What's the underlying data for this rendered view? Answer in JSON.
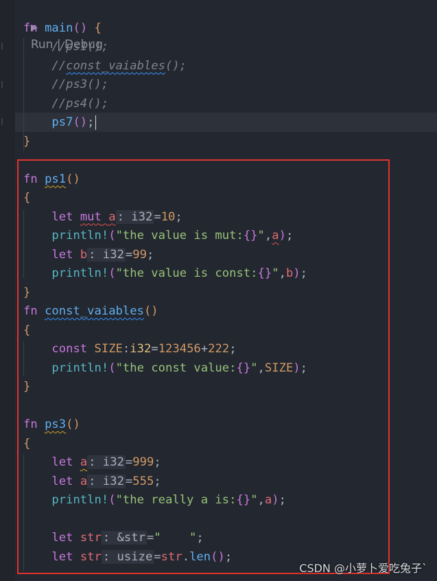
{
  "editor": {
    "codelens": {
      "run": "Run",
      "separator": " | ",
      "debug": "Debug"
    },
    "lines": [
      {
        "tokens": [
          {
            "t": "fn",
            "c": "kw"
          },
          {
            "t": " ",
            "c": "plain"
          },
          {
            "t": "main",
            "c": "fn"
          },
          {
            "t": "()",
            "c": "par"
          },
          {
            "t": " ",
            "c": "plain"
          },
          {
            "t": "{",
            "c": "brace"
          }
        ]
      },
      {
        "tokens": [
          {
            "t": "    ",
            "c": "plain"
          },
          {
            "t": "//ps1();",
            "c": "cm"
          }
        ]
      },
      {
        "tokens": [
          {
            "t": "    ",
            "c": "plain"
          },
          {
            "t": "//",
            "c": "cm"
          },
          {
            "t": "const_vaiables",
            "c": "cm sq-b"
          },
          {
            "t": "();",
            "c": "cm"
          }
        ]
      },
      {
        "tokens": [
          {
            "t": "    ",
            "c": "plain"
          },
          {
            "t": "//ps3();",
            "c": "cm"
          }
        ]
      },
      {
        "tokens": [
          {
            "t": "    ",
            "c": "plain"
          },
          {
            "t": "//ps4();",
            "c": "cm"
          }
        ]
      },
      {
        "tokens": [
          {
            "t": "    ",
            "c": "plain"
          },
          {
            "t": "ps7",
            "c": "fn"
          },
          {
            "t": "()",
            "c": "par"
          },
          {
            "t": ";",
            "c": "plain"
          }
        ],
        "cursor": true
      },
      {
        "tokens": [
          {
            "t": "}",
            "c": "brace"
          }
        ]
      },
      {
        "tokens": []
      },
      {
        "tokens": [
          {
            "t": "fn",
            "c": "kw"
          },
          {
            "t": " ",
            "c": "plain"
          },
          {
            "t": "ps1",
            "c": "fn sq-y"
          },
          {
            "t": "()",
            "c": "brace"
          }
        ]
      },
      {
        "tokens": [
          {
            "t": "{",
            "c": "brace"
          }
        ]
      },
      {
        "tokens": [
          {
            "t": "    ",
            "c": "plain"
          },
          {
            "t": "let",
            "c": "kw"
          },
          {
            "t": " ",
            "c": "plain"
          },
          {
            "t": "mut",
            "c": "kw sq-r"
          },
          {
            "t": " ",
            "c": "plain sq-r"
          },
          {
            "t": "a",
            "c": "var sq-r"
          },
          {
            "t": ": i32",
            "c": "hint"
          },
          {
            "t": "=",
            "c": "plain"
          },
          {
            "t": "10",
            "c": "num"
          },
          {
            "t": ";",
            "c": "plain"
          }
        ]
      },
      {
        "tokens": [
          {
            "t": "    ",
            "c": "plain"
          },
          {
            "t": "println!",
            "c": "mac"
          },
          {
            "t": "(",
            "c": "par"
          },
          {
            "t": "\"the value is mut:",
            "c": "str"
          },
          {
            "t": "{}",
            "c": "kw"
          },
          {
            "t": "\"",
            "c": "str"
          },
          {
            "t": ",",
            "c": "plain"
          },
          {
            "t": "a",
            "c": "var sq-r"
          },
          {
            "t": ")",
            "c": "par"
          },
          {
            "t": ";",
            "c": "plain"
          }
        ]
      },
      {
        "tokens": [
          {
            "t": "    ",
            "c": "plain"
          },
          {
            "t": "let",
            "c": "kw"
          },
          {
            "t": " ",
            "c": "plain"
          },
          {
            "t": "b",
            "c": "var"
          },
          {
            "t": ": i32",
            "c": "hint"
          },
          {
            "t": "=",
            "c": "plain"
          },
          {
            "t": "99",
            "c": "num"
          },
          {
            "t": ";",
            "c": "plain"
          }
        ]
      },
      {
        "tokens": [
          {
            "t": "    ",
            "c": "plain"
          },
          {
            "t": "println!",
            "c": "mac"
          },
          {
            "t": "(",
            "c": "par"
          },
          {
            "t": "\"the value is const:",
            "c": "str"
          },
          {
            "t": "{}",
            "c": "kw"
          },
          {
            "t": "\"",
            "c": "str"
          },
          {
            "t": ",",
            "c": "plain"
          },
          {
            "t": "b",
            "c": "var"
          },
          {
            "t": ")",
            "c": "par"
          },
          {
            "t": ";",
            "c": "plain"
          }
        ]
      },
      {
        "tokens": [
          {
            "t": "}",
            "c": "brace"
          }
        ]
      },
      {
        "tokens": [
          {
            "t": "fn",
            "c": "kw"
          },
          {
            "t": " ",
            "c": "plain"
          },
          {
            "t": "const_vaiables",
            "c": "fn sq-b"
          },
          {
            "t": "()",
            "c": "brace"
          }
        ]
      },
      {
        "tokens": [
          {
            "t": "{",
            "c": "brace"
          }
        ]
      },
      {
        "tokens": [
          {
            "t": "    ",
            "c": "plain"
          },
          {
            "t": "const",
            "c": "kw"
          },
          {
            "t": " ",
            "c": "plain"
          },
          {
            "t": "SIZE",
            "c": "num"
          },
          {
            "t": ":",
            "c": "plain"
          },
          {
            "t": "i32",
            "c": "ty"
          },
          {
            "t": "=",
            "c": "plain"
          },
          {
            "t": "123456",
            "c": "num"
          },
          {
            "t": "+",
            "c": "plain"
          },
          {
            "t": "222",
            "c": "num"
          },
          {
            "t": ";",
            "c": "plain"
          }
        ]
      },
      {
        "tokens": [
          {
            "t": "    ",
            "c": "plain"
          },
          {
            "t": "println!",
            "c": "mac"
          },
          {
            "t": "(",
            "c": "par"
          },
          {
            "t": "\"the const value:",
            "c": "str"
          },
          {
            "t": "{}",
            "c": "kw"
          },
          {
            "t": "\"",
            "c": "str"
          },
          {
            "t": ",",
            "c": "plain"
          },
          {
            "t": "SIZE",
            "c": "num"
          },
          {
            "t": ")",
            "c": "par"
          },
          {
            "t": ";",
            "c": "plain"
          }
        ]
      },
      {
        "tokens": [
          {
            "t": "}",
            "c": "brace"
          }
        ]
      },
      {
        "tokens": []
      },
      {
        "tokens": [
          {
            "t": "fn",
            "c": "kw"
          },
          {
            "t": " ",
            "c": "plain"
          },
          {
            "t": "ps3",
            "c": "fn sq-y"
          },
          {
            "t": "()",
            "c": "brace"
          }
        ]
      },
      {
        "tokens": [
          {
            "t": "{",
            "c": "brace"
          }
        ]
      },
      {
        "tokens": [
          {
            "t": "    ",
            "c": "plain"
          },
          {
            "t": "let",
            "c": "kw"
          },
          {
            "t": " ",
            "c": "plain"
          },
          {
            "t": "a",
            "c": "var sq-y"
          },
          {
            "t": ": i32",
            "c": "hint"
          },
          {
            "t": "=",
            "c": "plain"
          },
          {
            "t": "999",
            "c": "num"
          },
          {
            "t": ";",
            "c": "plain"
          }
        ]
      },
      {
        "tokens": [
          {
            "t": "    ",
            "c": "plain"
          },
          {
            "t": "let",
            "c": "kw"
          },
          {
            "t": " ",
            "c": "plain"
          },
          {
            "t": "a",
            "c": "var"
          },
          {
            "t": ": i32",
            "c": "hint"
          },
          {
            "t": "=",
            "c": "plain"
          },
          {
            "t": "555",
            "c": "num"
          },
          {
            "t": ";",
            "c": "plain"
          }
        ]
      },
      {
        "tokens": [
          {
            "t": "    ",
            "c": "plain"
          },
          {
            "t": "println!",
            "c": "mac"
          },
          {
            "t": "(",
            "c": "par"
          },
          {
            "t": "\"the really a is:",
            "c": "str"
          },
          {
            "t": "{}",
            "c": "kw"
          },
          {
            "t": "\"",
            "c": "str"
          },
          {
            "t": ",",
            "c": "plain"
          },
          {
            "t": "a",
            "c": "var"
          },
          {
            "t": ")",
            "c": "par"
          },
          {
            "t": ";",
            "c": "plain"
          }
        ]
      },
      {
        "tokens": []
      },
      {
        "tokens": [
          {
            "t": "    ",
            "c": "plain"
          },
          {
            "t": "let",
            "c": "kw"
          },
          {
            "t": " ",
            "c": "plain"
          },
          {
            "t": "str",
            "c": "var"
          },
          {
            "t": ": &str",
            "c": "hint"
          },
          {
            "t": "=",
            "c": "plain"
          },
          {
            "t": "\"    \"",
            "c": "str"
          },
          {
            "t": ";",
            "c": "plain"
          }
        ]
      },
      {
        "tokens": [
          {
            "t": "    ",
            "c": "plain"
          },
          {
            "t": "let",
            "c": "kw"
          },
          {
            "t": " ",
            "c": "plain"
          },
          {
            "t": "str",
            "c": "var"
          },
          {
            "t": ": usize",
            "c": "hint"
          },
          {
            "t": "=",
            "c": "plain"
          },
          {
            "t": "str",
            "c": "var"
          },
          {
            "t": ".",
            "c": "plain"
          },
          {
            "t": "len",
            "c": "fn"
          },
          {
            "t": "()",
            "c": "par"
          },
          {
            "t": ";",
            "c": "plain"
          }
        ]
      }
    ]
  },
  "watermark": {
    "text": "CSDN @小萝卜爱吃兔子`"
  },
  "colors": {
    "highlight_box": "#e0332f",
    "background": "#232730"
  }
}
